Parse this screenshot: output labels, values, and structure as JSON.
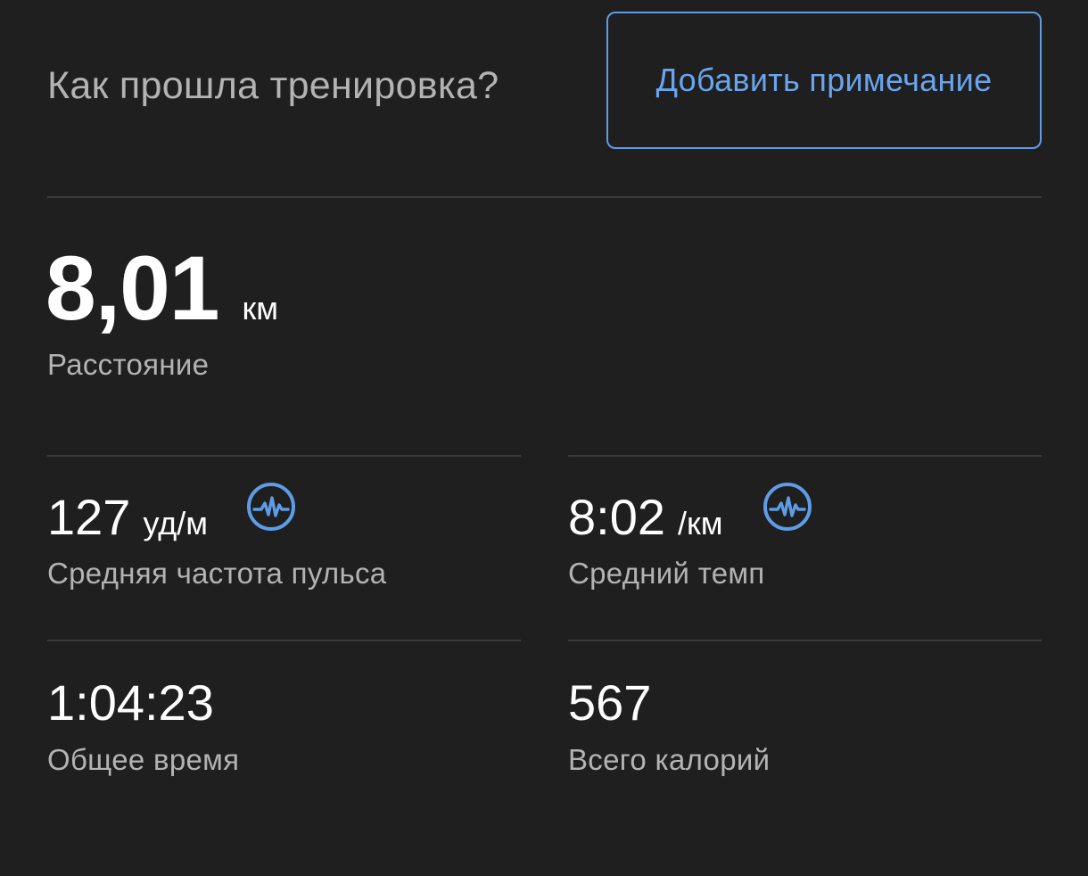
{
  "feedback": {
    "question": "Как прошла тренировка?",
    "add_note_label": "Добавить примечание"
  },
  "distance": {
    "value": "8,01",
    "unit": "км",
    "label": "Расстояние"
  },
  "stats": {
    "avg_hr": {
      "value": "127",
      "unit": "уд/м",
      "label": "Средняя частота пульса",
      "icon": "heart-rate-icon"
    },
    "avg_pace": {
      "value": "8:02",
      "unit": "/км",
      "label": "Средний темп",
      "icon": "heart-rate-icon"
    },
    "total_time": {
      "value": "1:04:23",
      "label": "Общее время"
    },
    "total_calories": {
      "value": "567",
      "label": "Всего калорий"
    }
  },
  "colors": {
    "background": "#1f1f1f",
    "accent": "#5e9ce6",
    "secondary_text": "#b3b3b3",
    "divider": "#3a3a3a"
  }
}
